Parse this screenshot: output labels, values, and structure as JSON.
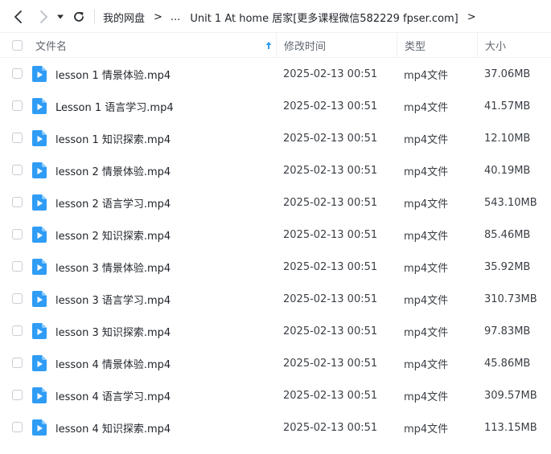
{
  "toolbar": {
    "back_icon": "chevron-left-icon",
    "forward_icon": "chevron-right-icon",
    "dropdown_icon": "caret-down-icon",
    "refresh_icon": "refresh-icon"
  },
  "breadcrumb": {
    "root": "我的网盘",
    "sep1": ">",
    "ellipsis": "...",
    "current": "Unit 1 At home 居家[更多课程微信582229 fpser.com]",
    "sep2": ">"
  },
  "columns": {
    "name": "文件名",
    "modified": "修改时间",
    "type": "类型",
    "size": "大小"
  },
  "colors": {
    "accent": "#2f9cf5",
    "icon_play": "#ffffff"
  },
  "files": [
    {
      "name": "lesson 1 情景体验.mp4",
      "modified": "2025-02-13 00:51",
      "type": "mp4文件",
      "size": "37.06MB"
    },
    {
      "name": "Lesson 1 语言学习.mp4",
      "modified": "2025-02-13 00:51",
      "type": "mp4文件",
      "size": "41.57MB"
    },
    {
      "name": "lesson 1 知识探索.mp4",
      "modified": "2025-02-13 00:51",
      "type": "mp4文件",
      "size": "12.10MB"
    },
    {
      "name": "lesson 2 情景体验.mp4",
      "modified": "2025-02-13 00:51",
      "type": "mp4文件",
      "size": "40.19MB"
    },
    {
      "name": "lesson 2 语言学习.mp4",
      "modified": "2025-02-13 00:51",
      "type": "mp4文件",
      "size": "543.10MB"
    },
    {
      "name": "lesson 2 知识探索.mp4",
      "modified": "2025-02-13 00:51",
      "type": "mp4文件",
      "size": "85.46MB"
    },
    {
      "name": "lesson 3 情景体验.mp4",
      "modified": "2025-02-13 00:51",
      "type": "mp4文件",
      "size": "35.92MB"
    },
    {
      "name": "lesson 3 语言学习.mp4",
      "modified": "2025-02-13 00:51",
      "type": "mp4文件",
      "size": "310.73MB"
    },
    {
      "name": "lesson 3 知识探索.mp4",
      "modified": "2025-02-13 00:51",
      "type": "mp4文件",
      "size": "97.83MB"
    },
    {
      "name": "lesson 4 情景体验.mp4",
      "modified": "2025-02-13 00:51",
      "type": "mp4文件",
      "size": "45.86MB"
    },
    {
      "name": "lesson 4 语言学习.mp4",
      "modified": "2025-02-13 00:51",
      "type": "mp4文件",
      "size": "309.57MB"
    },
    {
      "name": "lesson 4 知识探索.mp4",
      "modified": "2025-02-13 00:51",
      "type": "mp4文件",
      "size": "113.15MB"
    }
  ]
}
